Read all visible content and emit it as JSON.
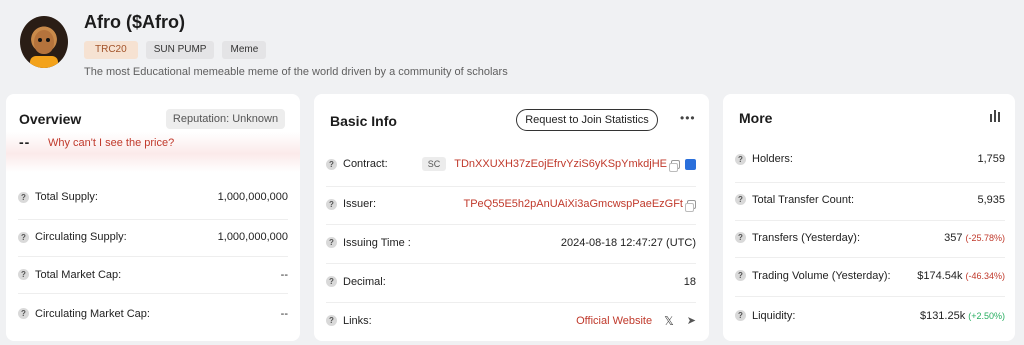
{
  "token": {
    "name": "Afro ($Afro)",
    "tags": [
      "TRC20",
      "SUN PUMP",
      "Meme"
    ],
    "description": "The most Educational memeable meme of the world driven by a community of scholars"
  },
  "overview": {
    "title": "Overview",
    "reputation": "Reputation: Unknown",
    "price": "--",
    "price_link": "Why can't I see the price?",
    "rows": [
      {
        "label": "Total Supply:",
        "value": "1,000,000,000"
      },
      {
        "label": "Circulating Supply:",
        "value": "1,000,000,000"
      },
      {
        "label": "Total Market Cap:",
        "value": "--"
      },
      {
        "label": "Circulating Market Cap:",
        "value": "--"
      }
    ]
  },
  "basic_info": {
    "title": "Basic Info",
    "join_button": "Request to Join Statistics",
    "more_icon": "more-icon",
    "contract_label": "Contract:",
    "contract_badge": "SC",
    "contract_value": "TDnXXUXH37zEojEfrvYziS6yKSpYmkdjHE",
    "issuer_label": "Issuer:",
    "issuer_value": "TPeQ55E5h2pAnUAiXi3aGmcwspPaeEzGFt",
    "issuing_time_label": "Issuing Time :",
    "issuing_time_value": "2024-08-18 12:47:27 (UTC)",
    "decimal_label": "Decimal:",
    "decimal_value": "18",
    "links_label": "Links:",
    "official_website": "Official Website"
  },
  "more": {
    "title": "More",
    "holders_label": "Holders:",
    "holders_value": "1,759",
    "transfer_count_label": "Total Transfer Count:",
    "transfer_count_value": "5,935",
    "transfers_label": "Transfers (Yesterday):",
    "transfers_value": "357",
    "transfers_change": "(-25.78%)",
    "volume_label": "Trading Volume (Yesterday):",
    "volume_value": "$174.54k",
    "volume_change": "(-46.34%)",
    "liquidity_label": "Liquidity:",
    "liquidity_value": "$131.25k",
    "liquidity_change": "(+2.50%)"
  },
  "colors": {
    "accent_red": "#c0392b",
    "positive_green": "#27ae60",
    "tag_trc20_bg": "#f6e2d2"
  }
}
